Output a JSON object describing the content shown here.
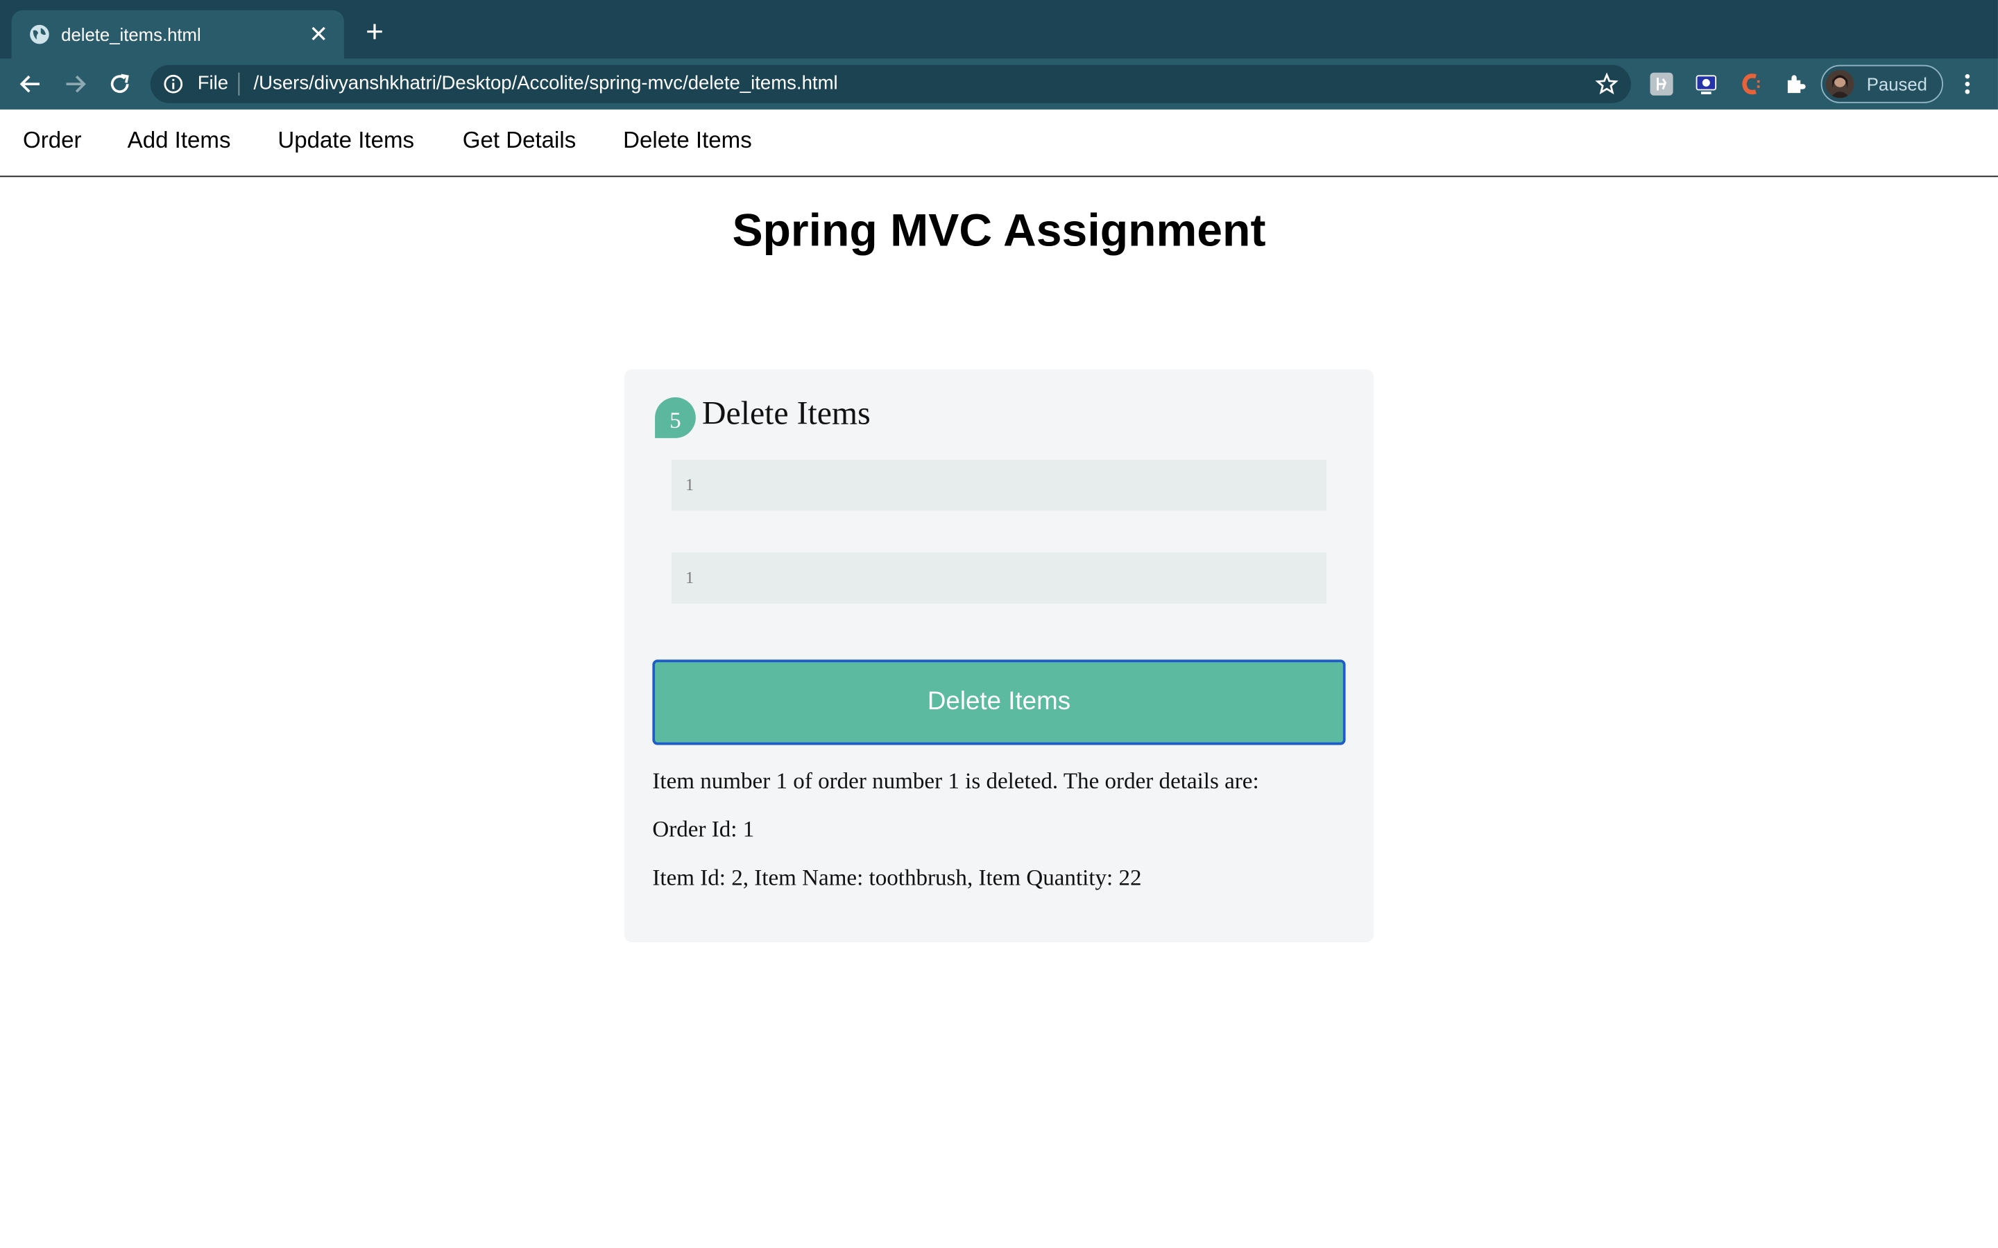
{
  "browser": {
    "tab_title": "delete_items.html",
    "omnibox_scheme": "File",
    "url": "/Users/divyanshkhatri/Desktop/Accolite/spring-mvc/delete_items.html",
    "profile_label": "Paused"
  },
  "nav": {
    "items": [
      "Order",
      "Add Items",
      "Update Items",
      "Get Details",
      "Delete Items"
    ]
  },
  "page": {
    "title": "Spring MVC Assignment"
  },
  "form": {
    "step_number": "5",
    "heading": "Delete Items",
    "field_1_value": "1",
    "field_2_value": "1",
    "submit_label": "Delete Items"
  },
  "result": {
    "message": "Item number 1 of order number 1 is deleted. The order details are:",
    "order_line": "Order Id: 1",
    "item_line": "Item Id: 2, Item Name: toothbrush, Item Quantity: 22"
  },
  "colors": {
    "tabbar_bg": "#1d4454",
    "toolbar_bg": "#2a5b6b",
    "accent_green": "#5bba9f",
    "button_border": "#1e5ccc"
  },
  "icons": [
    "globe-icon",
    "close-icon",
    "plus-icon",
    "back-arrow-icon",
    "forward-arrow-icon",
    "reload-icon",
    "info-icon",
    "star-icon",
    "extension-icon",
    "puzzle-icon",
    "menu-icon"
  ]
}
